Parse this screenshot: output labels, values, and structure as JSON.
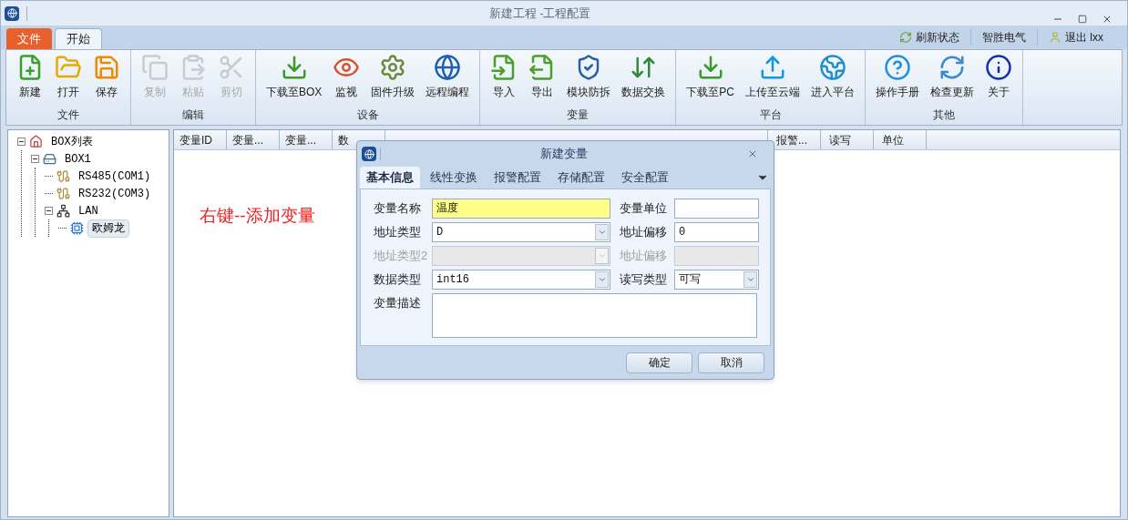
{
  "window": {
    "title": "新建工程 -工程配置"
  },
  "ribbon": {
    "tabs": [
      {
        "label": "文件",
        "kind": "file",
        "selected": false
      },
      {
        "label": "开始",
        "kind": "normal",
        "selected": true
      }
    ],
    "right_items": [
      {
        "label": "刷新状态",
        "kind": "refresh"
      },
      {
        "label": "智胜电气",
        "kind": "plain"
      },
      {
        "label": "退出 lxx",
        "kind": "user"
      }
    ],
    "groups": [
      {
        "label": "文件",
        "buttons": [
          {
            "label": "新建",
            "kind": "new",
            "disabled": false
          },
          {
            "label": "打开",
            "kind": "open",
            "disabled": false
          },
          {
            "label": "保存",
            "kind": "save",
            "disabled": false
          }
        ]
      },
      {
        "label": "编辑",
        "buttons": [
          {
            "label": "复制",
            "kind": "copy",
            "disabled": true
          },
          {
            "label": "粘贴",
            "kind": "paste",
            "disabled": true
          },
          {
            "label": "剪切",
            "kind": "cut",
            "disabled": true
          }
        ]
      },
      {
        "label": "设备",
        "buttons": [
          {
            "label": "下载至BOX",
            "kind": "download",
            "disabled": false
          },
          {
            "label": "监视",
            "kind": "monitor",
            "disabled": false
          },
          {
            "label": "固件升级",
            "kind": "gear",
            "disabled": false
          },
          {
            "label": "远程编程",
            "kind": "globe",
            "disabled": false
          }
        ]
      },
      {
        "label": "变量",
        "buttons": [
          {
            "label": "导入",
            "kind": "import",
            "disabled": false
          },
          {
            "label": "导出",
            "kind": "export",
            "disabled": false
          },
          {
            "label": "模块防拆",
            "kind": "shield",
            "disabled": false
          },
          {
            "label": "数据交换",
            "kind": "exchange",
            "disabled": false
          }
        ]
      },
      {
        "label": "平台",
        "buttons": [
          {
            "label": "下载至PC",
            "kind": "download",
            "disabled": false
          },
          {
            "label": "上传至云端",
            "kind": "upload",
            "disabled": false
          },
          {
            "label": "进入平台",
            "kind": "earth",
            "disabled": false
          }
        ]
      },
      {
        "label": "其他",
        "buttons": [
          {
            "label": "操作手册",
            "kind": "help",
            "disabled": false
          },
          {
            "label": "检查更新",
            "kind": "update",
            "disabled": false
          },
          {
            "label": "关于",
            "kind": "info",
            "disabled": false
          }
        ]
      }
    ]
  },
  "tree": [
    {
      "label": "BOX列表",
      "kind": "home",
      "expanded": true,
      "selected": false,
      "children": [
        {
          "label": "BOX1",
          "kind": "box",
          "expanded": true,
          "selected": false,
          "children": [
            {
              "label": "RS485(COM1)",
              "kind": "port",
              "selected": false
            },
            {
              "label": "RS232(COM3)",
              "kind": "port",
              "selected": false
            },
            {
              "label": "LAN",
              "kind": "lan",
              "expanded": true,
              "selected": false,
              "children": [
                {
                  "label": "欧姆龙",
                  "kind": "device",
                  "selected": true
                }
              ]
            }
          ]
        }
      ]
    }
  ],
  "hint": "右键--添加变量",
  "table": {
    "columns_left": [
      "变量ID",
      "变量...",
      "变量...",
      "数"
    ],
    "columns_right": [
      "报警...",
      "读写",
      "单位"
    ]
  },
  "dialog": {
    "title": "新建变量",
    "tabs": [
      {
        "label": "基本信息",
        "selected": true
      },
      {
        "label": "线性变换",
        "selected": false
      },
      {
        "label": "报警配置",
        "selected": false
      },
      {
        "label": "存储配置",
        "selected": false
      },
      {
        "label": "安全配置",
        "selected": false
      }
    ],
    "rows": [
      {
        "left": {
          "label": "变量名称",
          "kind": "text",
          "value": "温度",
          "highlighted": true,
          "disabled": false
        },
        "right": {
          "label": "变量单位",
          "kind": "text",
          "disabled": false
        }
      },
      {
        "left": {
          "label": "地址类型",
          "kind": "select",
          "value": "D",
          "disabled": false
        },
        "right": {
          "label": "地址偏移",
          "kind": "text",
          "value": "0",
          "disabled": false
        }
      },
      {
        "left": {
          "label": "地址类型2",
          "kind": "select",
          "disabled": true
        },
        "right": {
          "label": "地址偏移",
          "kind": "text",
          "disabled": true
        }
      },
      {
        "left": {
          "label": "数据类型",
          "kind": "select",
          "value": "int16",
          "disabled": false
        },
        "right": {
          "label": "读写类型",
          "kind": "select",
          "value": "可写",
          "disabled": false
        }
      }
    ],
    "description": {
      "label": "变量描述"
    },
    "buttons": [
      "确定",
      "取消"
    ]
  }
}
